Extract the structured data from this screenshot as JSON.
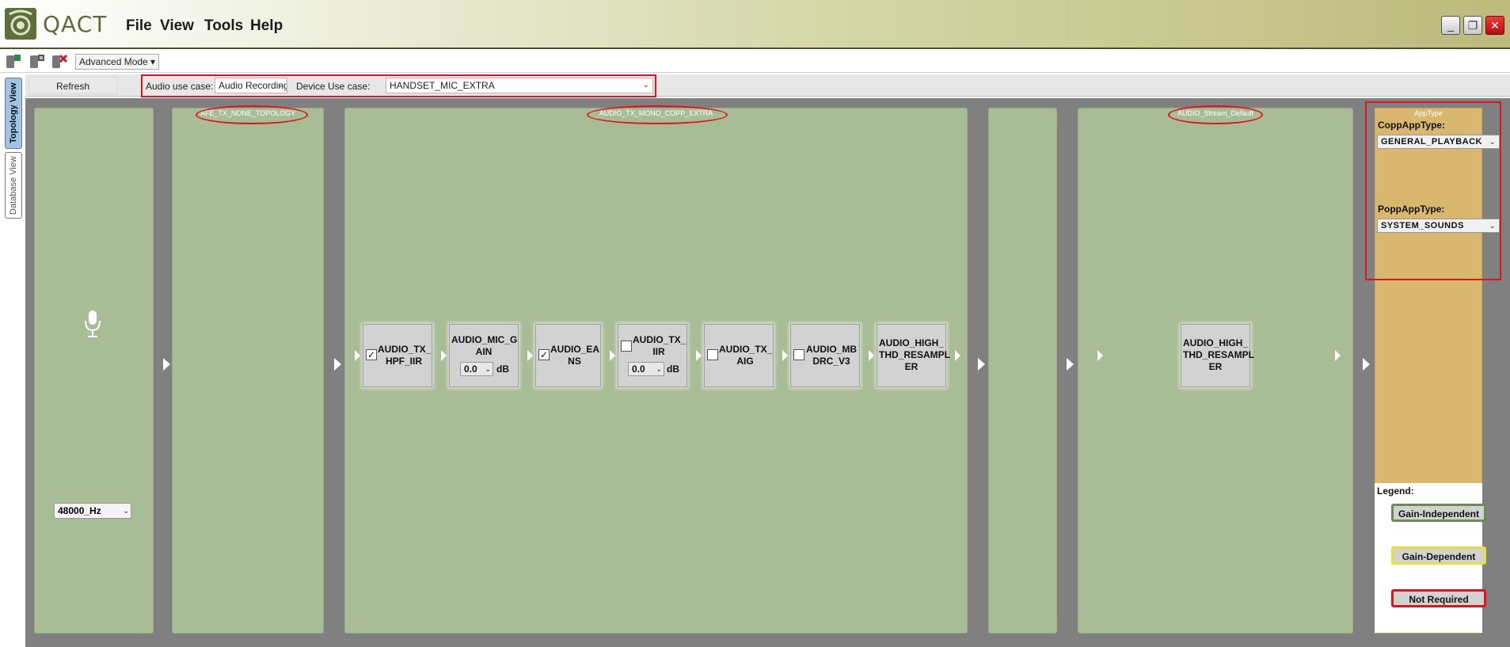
{
  "app": {
    "name": "QACT",
    "menu": [
      "File",
      "View",
      "Tools",
      "Help"
    ],
    "window_controls": {
      "minimize": "_",
      "restore": "❐",
      "close": "✕"
    }
  },
  "toolbar": {
    "icons": [
      "save-device-icon",
      "save-all-icon",
      "disconnect-icon"
    ],
    "mode_label": "Advanced Mode ▾"
  },
  "side_tabs": [
    "Topology View",
    "Database View"
  ],
  "filter": {
    "refresh_label": "Refresh",
    "audio_use_case_label": "Audio use case:",
    "audio_use_case_value": "Audio Recording",
    "device_use_case_label": "Device Use case:",
    "device_use_case_value": "HANDSET_MIC_EXTRA"
  },
  "panels": {
    "device": {
      "sample_rate": "48000_Hz"
    },
    "afe": {
      "title": "AFE_TX_NONE_TOPOLOGY"
    },
    "copp": {
      "title": "AUDIO_TX_MONO_COPP_EXTRA",
      "modules": [
        {
          "label": "AUDIO_TX_ HPF_IIR",
          "checkbox": true,
          "checked": true
        },
        {
          "label": "AUDIO_MIC_G AIN",
          "gain": "0.0",
          "unit": "dB"
        },
        {
          "label": "AUDIO_EA NS",
          "checkbox": true,
          "checked": true
        },
        {
          "label": "AUDIO_TX_ IIR",
          "checkbox": true,
          "checked": false,
          "gain": "0.0",
          "unit": "dB"
        },
        {
          "label": "AUDIO_TX_ AIG",
          "checkbox": true,
          "checked": false
        },
        {
          "label": "AUDIO_MB DRC_V3",
          "checkbox": true,
          "checked": false
        },
        {
          "label": "AUDIO_HIGH_ THD_RESAMPL ER"
        }
      ]
    },
    "stream": {
      "title": "AUDIO_Stream_Default",
      "modules": [
        {
          "label": "AUDIO_HIGH_ THD_RESAMPL ER"
        }
      ]
    },
    "apptype": {
      "title": "AppType",
      "copp_label": "CoppAppType:",
      "copp_value": "GENERAL_PLAYBACK",
      "popp_label": "PoppAppType:",
      "popp_value": "SYSTEM_SOUNDS"
    }
  },
  "legend": {
    "title": "Legend:",
    "items": [
      {
        "label": "Gain-Independent",
        "color": "#6a8a5a"
      },
      {
        "label": "Gain-Dependent",
        "color": "#e6e23a"
      },
      {
        "label": "Not Required",
        "color": "#e0141c"
      }
    ]
  },
  "colors": {
    "panel_green": "#a8bc96",
    "apptype_orange": "#dab76f",
    "highlight_red": "#e0141c",
    "canvas_gray": "#808080"
  }
}
